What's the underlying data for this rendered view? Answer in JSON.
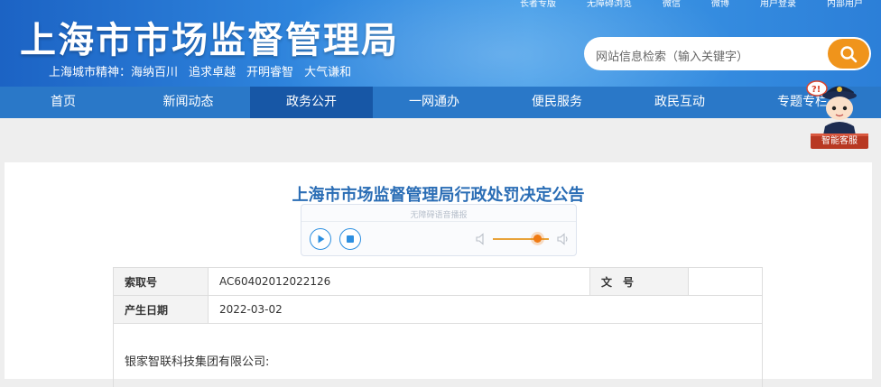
{
  "header": {
    "site_title": "上海市市场监督管理局",
    "slogan_prefix": "上海城市精神：",
    "slogan_items": [
      "海纳百川",
      "追求卓越",
      "开明睿智",
      "大气谦和"
    ],
    "top_links": [
      "长者专版",
      "无障碍浏览",
      "微信",
      "微博",
      "用户登录",
      "内部用户"
    ],
    "search_placeholder": "网站信息检索（输入关键字）"
  },
  "nav": {
    "items": [
      "首页",
      "新闻动态",
      "政务公开",
      "一网通办",
      "便民服务",
      "政民互动",
      "专题专栏"
    ],
    "active_index": 2
  },
  "assistant": {
    "label": "智能客服"
  },
  "document": {
    "title": "上海市市场监督管理局行政处罚决定公告",
    "player_title": "无障碍语音播报",
    "volume_level": 0.8,
    "meta": {
      "index_label": "索取号",
      "index_value": "AC60402012022126",
      "doc_no_label": "文　号",
      "doc_no_value": "",
      "date_label": "产生日期",
      "date_value": "2022-03-02"
    },
    "body_first_line": "银家智联科技集团有限公司:"
  },
  "colors": {
    "header_blue": "#2f86de",
    "nav_blue": "#2a78c8",
    "nav_active": "#1757a6",
    "search_button": "#f0941b",
    "title_blue": "#2a6db5"
  }
}
